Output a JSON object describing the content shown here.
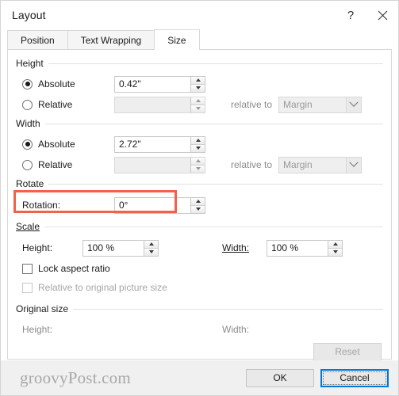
{
  "window": {
    "title": "Layout",
    "help_icon": "question-mark-icon",
    "close_icon": "close-icon",
    "help_glyph": "?"
  },
  "tabs": [
    {
      "label": "Position",
      "active": false
    },
    {
      "label": "Text Wrapping",
      "active": false
    },
    {
      "label": "Size",
      "active": true
    }
  ],
  "height_group": {
    "title": "Height",
    "absolute_label": "Absolute",
    "absolute_value": "0.42\"",
    "absolute_selected": true,
    "relative_label": "Relative",
    "relative_value": "",
    "relative_selected": false,
    "relative_to_label": "relative to",
    "relative_to_value": "Margin"
  },
  "width_group": {
    "title": "Width",
    "absolute_label": "Absolute",
    "absolute_value": "2.72\"",
    "absolute_selected": true,
    "relative_label": "Relative",
    "relative_value": "",
    "relative_selected": false,
    "relative_to_label": "relative to",
    "relative_to_value": "Margin"
  },
  "rotate_group": {
    "title": "Rotate",
    "rotation_label": "Rotation:",
    "rotation_value": "0°",
    "highlight_color": "#f4604d"
  },
  "scale_group": {
    "title": "Scale",
    "height_label": "Height:",
    "height_value": "100 %",
    "width_label": "Width:",
    "width_value": "100 %",
    "lock_aspect_label": "Lock aspect ratio",
    "lock_aspect_checked": false,
    "relative_original_label": "Relative to original picture size",
    "relative_original_checked": false,
    "relative_original_disabled": true
  },
  "original_size_group": {
    "title": "Original size",
    "height_label": "Height:",
    "height_value": "",
    "width_label": "Width:",
    "width_value": "",
    "reset_label": "Reset",
    "reset_disabled": true
  },
  "footer": {
    "watermark": "groovyPost.com",
    "ok_label": "OK",
    "cancel_label": "Cancel",
    "cancel_focused": true
  }
}
